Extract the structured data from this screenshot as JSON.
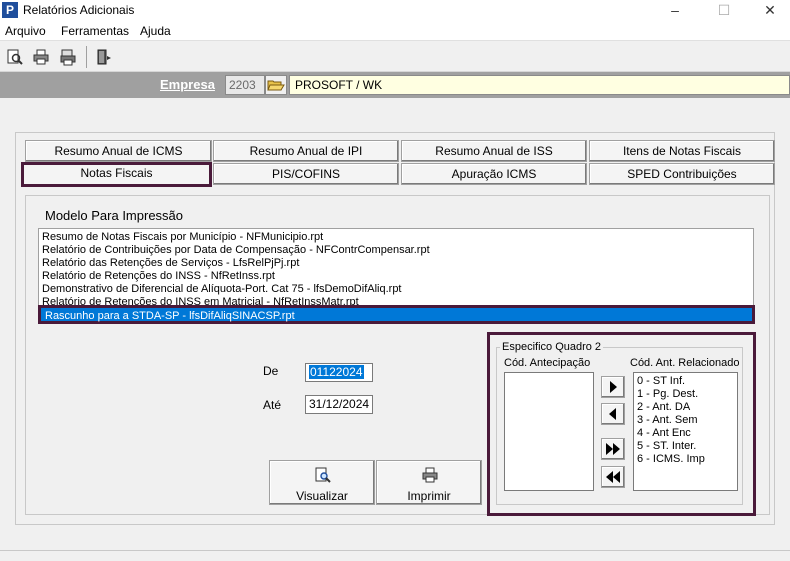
{
  "window": {
    "title": "Relatórios Adicionais",
    "app_icon": "P",
    "minimize": "–",
    "maximize": "☐",
    "close": "✕"
  },
  "menu": {
    "items": [
      "Arquivo",
      "Ferramentas",
      "Ajuda"
    ]
  },
  "empresa": {
    "label": "Empresa",
    "code": "2203",
    "name": "PROSOFT / WK"
  },
  "tabs": [
    "Resumo Anual de ICMS",
    "Resumo Anual de IPI",
    "Resumo Anual de ISS",
    "Itens de Notas Fiscais",
    "Notas Fiscais",
    "PIS/COFINS",
    "Apuração ICMS",
    "SPED Contribuições"
  ],
  "selected_tab": "Notas Fiscais",
  "model": {
    "title": "Modelo Para Impressão",
    "items": [
      "Resumo de Notas Fiscais por Município - NFMunicipio.rpt",
      "Relatório de Contribuições por Data de Compensação - NFContrCompensar.rpt",
      "Relatório das Retenções de Serviços - LfsRelPjPj.rpt",
      "Relatório de Retenções do INSS - NfRetInss.rpt",
      "Demonstrativo de Diferencial de Alíquota-Port. Cat 75 - lfsDemoDifAliq.rpt",
      "Relatório de Retenções do INSS em Matricial - NfRetInssMatr.rpt"
    ],
    "selected_item": "Rascunho para a STDA-SP - lfsDifAliqSINACSP.rpt"
  },
  "dates": {
    "de_label": "De",
    "de_value": "01122024",
    "ate_label": "Até",
    "ate_value": "31/12/2024"
  },
  "buttons": {
    "visualizar": "Visualizar",
    "imprimir": "Imprimir"
  },
  "especifico": {
    "title": "Especifico Quadro 2",
    "left_label": "Cód. Antecipação",
    "right_label": "Cód. Ant. Relacionado",
    "right_items": [
      "0 - ST Inf.",
      "1 - Pg. Dest.",
      "2 - Ant. DA",
      "3 - Ant. Sem",
      "4 - Ant Enc",
      "5 - ST. Inter.",
      "6 - ICMS. Imp"
    ]
  },
  "colors": {
    "selection": "#0078d7",
    "highlight_frame": "#4a1a3a",
    "empresa_bar": "#a0a0a0",
    "empresa_name_bg": "#ffffe1"
  }
}
